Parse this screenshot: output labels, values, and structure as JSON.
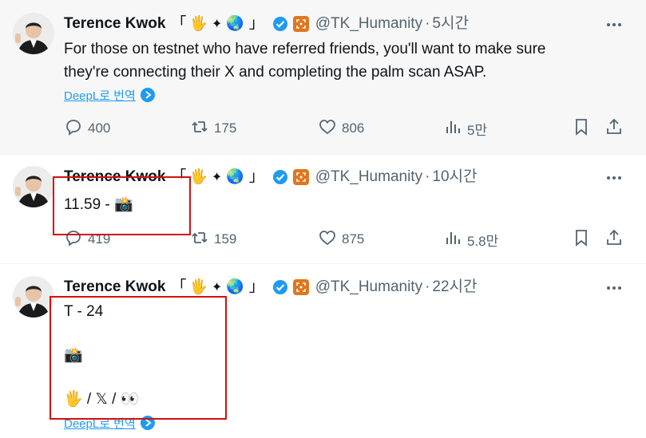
{
  "tweets": [
    {
      "author": {
        "name": "Terence Kwok",
        "bracket_open": "「",
        "bracket_close": "」",
        "handle": "@TK_Humanity",
        "emoji_hand": "🖐",
        "emoji_sparkle": "✦",
        "emoji_globe": "🌏"
      },
      "separator": "·",
      "time": "5시간",
      "text_lines": [
        "For those on testnet who have referred friends, you'll want to make sure",
        "they're connecting their X and completing the palm scan ASAP."
      ],
      "translate_label": "DeepL로 번역",
      "stats": {
        "replies": "400",
        "retweets": "175",
        "likes": "806",
        "views": "5만"
      }
    },
    {
      "author": {
        "name": "Terence Kwok",
        "bracket_open": "「",
        "bracket_close": "」",
        "handle": "@TK_Humanity",
        "emoji_hand": "🖐",
        "emoji_sparkle": "✦",
        "emoji_globe": "🌏"
      },
      "separator": "·",
      "time": "10시간",
      "text_lines": [
        "11.59 - 📸"
      ],
      "stats": {
        "replies": "419",
        "retweets": "159",
        "likes": "875",
        "views": "5.8만"
      }
    },
    {
      "author": {
        "name": "Terence Kwok",
        "bracket_open": "「",
        "bracket_close": "」",
        "handle": "@TK_Humanity",
        "emoji_hand": "🖐",
        "emoji_sparkle": "✦",
        "emoji_globe": "🌏"
      },
      "separator": "·",
      "time": "22시간",
      "text_lines": [
        "T - 24",
        "",
        "📸",
        "",
        "🖐 / 𝕏 / 👀"
      ],
      "translate_label": "DeepL로 번역"
    }
  ],
  "icons": {
    "more": "more-icon",
    "reply": "reply-icon",
    "retweet": "retweet-icon",
    "like": "heart-icon",
    "views": "views-icon",
    "bookmark": "bookmark-icon",
    "share": "share-icon"
  },
  "colors": {
    "verified": "#1d9bf0",
    "link": "#1d9bf0",
    "secondary_text": "#536471",
    "highlight_box": "#d30f0f",
    "badge": "#e0761f"
  }
}
